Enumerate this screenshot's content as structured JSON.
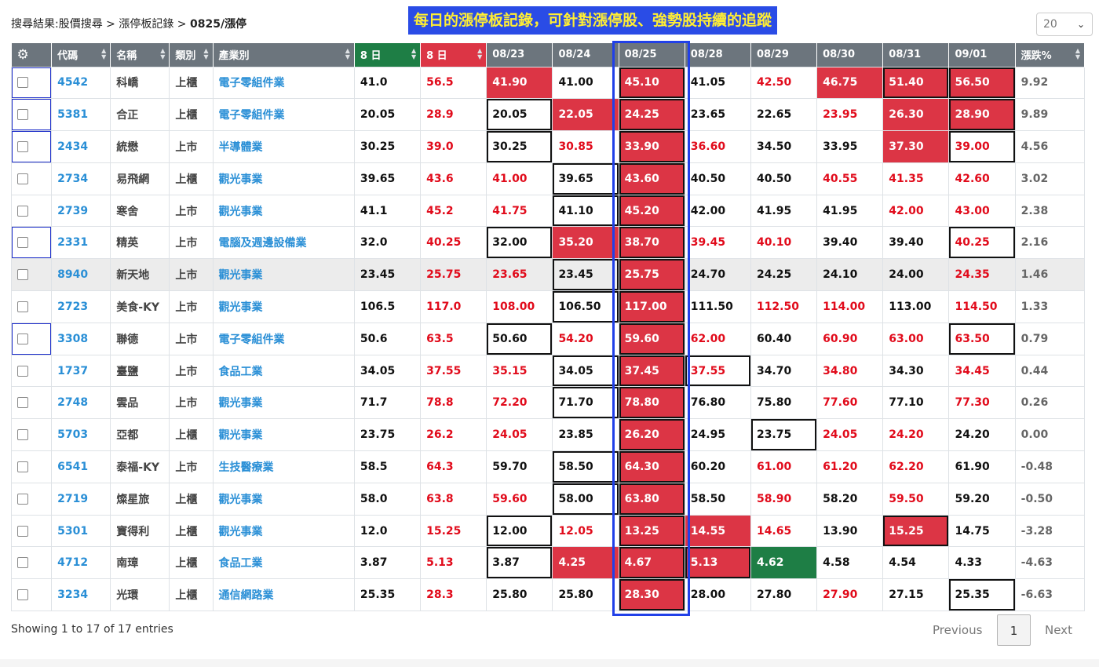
{
  "breadcrumb": {
    "prefix": "搜尋結果:股價搜尋 > 漲停板記錄 > ",
    "current": "0825/漲停"
  },
  "banner": "每日的漲停板記錄，可針對漲停股、強勢股持續的追蹤",
  "page_size": "20",
  "columns": [
    "代碼",
    "名稱",
    "類別",
    "產業別",
    "8 日",
    "8 日",
    "08/23",
    "08/24",
    "08/25",
    "08/28",
    "08/29",
    "08/30",
    "08/31",
    "09/01",
    "漲跌%"
  ],
  "rows": [
    {
      "code": "4542",
      "name": "科嶠",
      "mkt": "上櫃",
      "ind": "電子零組件業",
      "a": "41.0",
      "b": "56.5",
      "d": [
        "41.90",
        "41.00",
        "45.10",
        "41.05",
        "42.50",
        "46.75",
        "51.40",
        "56.50"
      ],
      "s": [
        "up",
        "k",
        "up",
        "k",
        "r",
        "up",
        "up",
        "up"
      ],
      "box": [
        false,
        false,
        true,
        false,
        false,
        false,
        true,
        true
      ],
      "chg": "9.92",
      "sel": true,
      "hl": false
    },
    {
      "code": "5381",
      "name": "合正",
      "mkt": "上櫃",
      "ind": "電子零組件業",
      "a": "20.05",
      "b": "28.9",
      "d": [
        "20.05",
        "22.05",
        "24.25",
        "23.65",
        "22.65",
        "23.95",
        "26.30",
        "28.90"
      ],
      "s": [
        "k",
        "up",
        "up",
        "k",
        "k",
        "r",
        "up",
        "up"
      ],
      "box": [
        true,
        false,
        true,
        false,
        false,
        false,
        false,
        true
      ],
      "chg": "9.89",
      "sel": true,
      "hl": false
    },
    {
      "code": "2434",
      "name": "統懋",
      "mkt": "上市",
      "ind": "半導體業",
      "a": "30.25",
      "b": "39.0",
      "d": [
        "30.25",
        "30.85",
        "33.90",
        "36.60",
        "34.50",
        "33.95",
        "37.30",
        "39.00"
      ],
      "s": [
        "k",
        "r",
        "up",
        "r",
        "k",
        "k",
        "up",
        "r"
      ],
      "box": [
        true,
        false,
        true,
        false,
        false,
        false,
        false,
        true
      ],
      "chg": "4.56",
      "sel": true,
      "hl": false
    },
    {
      "code": "2734",
      "name": "易飛網",
      "mkt": "上櫃",
      "ind": "觀光事業",
      "a": "39.65",
      "b": "43.6",
      "d": [
        "41.00",
        "39.65",
        "43.60",
        "40.50",
        "40.50",
        "40.55",
        "41.35",
        "42.60"
      ],
      "s": [
        "r",
        "k",
        "up",
        "k",
        "k",
        "r",
        "r",
        "r"
      ],
      "box": [
        false,
        true,
        true,
        false,
        false,
        false,
        false,
        false
      ],
      "chg": "3.02",
      "sel": false,
      "hl": false
    },
    {
      "code": "2739",
      "name": "寒舍",
      "mkt": "上市",
      "ind": "觀光事業",
      "a": "41.1",
      "b": "45.2",
      "d": [
        "41.75",
        "41.10",
        "45.20",
        "42.00",
        "41.95",
        "41.95",
        "42.00",
        "43.00"
      ],
      "s": [
        "r",
        "k",
        "up",
        "k",
        "k",
        "k",
        "r",
        "r"
      ],
      "box": [
        false,
        true,
        true,
        false,
        false,
        false,
        false,
        false
      ],
      "chg": "2.38",
      "sel": false,
      "hl": false
    },
    {
      "code": "2331",
      "name": "精英",
      "mkt": "上市",
      "ind": "電腦及週邊設備業",
      "a": "32.0",
      "b": "40.25",
      "d": [
        "32.00",
        "35.20",
        "38.70",
        "39.45",
        "40.10",
        "39.40",
        "39.40",
        "40.25"
      ],
      "s": [
        "k",
        "up",
        "up",
        "r",
        "r",
        "k",
        "k",
        "r"
      ],
      "box": [
        true,
        false,
        true,
        false,
        false,
        false,
        false,
        true
      ],
      "chg": "2.16",
      "sel": true,
      "hl": false
    },
    {
      "code": "8940",
      "name": "新天地",
      "mkt": "上市",
      "ind": "觀光事業",
      "a": "23.45",
      "b": "25.75",
      "d": [
        "23.65",
        "23.45",
        "25.75",
        "24.70",
        "24.25",
        "24.10",
        "24.00",
        "24.35"
      ],
      "s": [
        "r",
        "k",
        "up",
        "k",
        "k",
        "k",
        "k",
        "r"
      ],
      "box": [
        false,
        true,
        true,
        false,
        false,
        false,
        false,
        false
      ],
      "chg": "1.46",
      "sel": false,
      "hl": true
    },
    {
      "code": "2723",
      "name": "美食-KY",
      "mkt": "上市",
      "ind": "觀光事業",
      "a": "106.5",
      "b": "117.0",
      "d": [
        "108.00",
        "106.50",
        "117.00",
        "111.50",
        "112.50",
        "114.00",
        "113.00",
        "114.50"
      ],
      "s": [
        "r",
        "k",
        "up",
        "k",
        "r",
        "r",
        "k",
        "r"
      ],
      "box": [
        false,
        true,
        true,
        false,
        false,
        false,
        false,
        false
      ],
      "chg": "1.33",
      "sel": false,
      "hl": false
    },
    {
      "code": "3308",
      "name": "聯德",
      "mkt": "上市",
      "ind": "電子零組件業",
      "a": "50.6",
      "b": "63.5",
      "d": [
        "50.60",
        "54.20",
        "59.60",
        "62.00",
        "60.40",
        "60.90",
        "63.00",
        "63.50"
      ],
      "s": [
        "k",
        "r",
        "up",
        "r",
        "k",
        "r",
        "r",
        "r"
      ],
      "box": [
        true,
        false,
        true,
        false,
        false,
        false,
        false,
        true
      ],
      "chg": "0.79",
      "sel": true,
      "hl": false
    },
    {
      "code": "1737",
      "name": "臺鹽",
      "mkt": "上市",
      "ind": "食品工業",
      "a": "34.05",
      "b": "37.55",
      "d": [
        "35.15",
        "34.05",
        "37.45",
        "37.55",
        "34.70",
        "34.80",
        "34.30",
        "34.45"
      ],
      "s": [
        "r",
        "k",
        "up",
        "r",
        "k",
        "r",
        "k",
        "r"
      ],
      "box": [
        false,
        true,
        true,
        true,
        false,
        false,
        false,
        false
      ],
      "chg": "0.44",
      "sel": false,
      "hl": false
    },
    {
      "code": "2748",
      "name": "雲品",
      "mkt": "上市",
      "ind": "觀光事業",
      "a": "71.7",
      "b": "78.8",
      "d": [
        "72.20",
        "71.70",
        "78.80",
        "76.80",
        "75.80",
        "77.60",
        "77.10",
        "77.30"
      ],
      "s": [
        "r",
        "k",
        "up",
        "k",
        "k",
        "r",
        "k",
        "r"
      ],
      "box": [
        false,
        true,
        true,
        false,
        false,
        false,
        false,
        false
      ],
      "chg": "0.26",
      "sel": false,
      "hl": false
    },
    {
      "code": "5703",
      "name": "亞都",
      "mkt": "上櫃",
      "ind": "觀光事業",
      "a": "23.75",
      "b": "26.2",
      "d": [
        "24.05",
        "23.85",
        "26.20",
        "24.95",
        "23.75",
        "24.05",
        "24.20",
        "24.20"
      ],
      "s": [
        "r",
        "k",
        "up",
        "k",
        "k",
        "r",
        "r",
        "k"
      ],
      "box": [
        false,
        false,
        true,
        false,
        true,
        false,
        false,
        false
      ],
      "chg": "0.00",
      "sel": false,
      "hl": false
    },
    {
      "code": "6541",
      "name": "泰福-KY",
      "mkt": "上市",
      "ind": "生技醫療業",
      "a": "58.5",
      "b": "64.3",
      "d": [
        "59.70",
        "58.50",
        "64.30",
        "60.20",
        "61.00",
        "61.20",
        "62.20",
        "61.90"
      ],
      "s": [
        "k",
        "k",
        "up",
        "k",
        "r",
        "r",
        "r",
        "k"
      ],
      "box": [
        false,
        true,
        true,
        false,
        false,
        false,
        false,
        false
      ],
      "chg": "-0.48",
      "sel": false,
      "hl": false
    },
    {
      "code": "2719",
      "name": "燦星旅",
      "mkt": "上櫃",
      "ind": "觀光事業",
      "a": "58.0",
      "b": "63.8",
      "d": [
        "59.60",
        "58.00",
        "63.80",
        "58.50",
        "58.90",
        "58.20",
        "59.50",
        "59.20"
      ],
      "s": [
        "r",
        "k",
        "up",
        "k",
        "r",
        "k",
        "r",
        "k"
      ],
      "box": [
        false,
        true,
        true,
        false,
        false,
        false,
        false,
        false
      ],
      "chg": "-0.50",
      "sel": false,
      "hl": false
    },
    {
      "code": "5301",
      "name": "寶得利",
      "mkt": "上櫃",
      "ind": "觀光事業",
      "a": "12.0",
      "b": "15.25",
      "d": [
        "12.00",
        "12.05",
        "13.25",
        "14.55",
        "14.65",
        "13.90",
        "15.25",
        "14.75"
      ],
      "s": [
        "k",
        "r",
        "up",
        "up",
        "r",
        "k",
        "up",
        "k"
      ],
      "box": [
        true,
        false,
        true,
        false,
        false,
        false,
        true,
        false
      ],
      "chg": "-3.28",
      "sel": false,
      "hl": false
    },
    {
      "code": "4712",
      "name": "南璋",
      "mkt": "上櫃",
      "ind": "食品工業",
      "a": "3.87",
      "b": "5.13",
      "d": [
        "3.87",
        "4.25",
        "4.67",
        "5.13",
        "4.62",
        "4.58",
        "4.54",
        "4.33"
      ],
      "s": [
        "k",
        "up",
        "up",
        "up",
        "dn",
        "k",
        "k",
        "k"
      ],
      "box": [
        true,
        false,
        true,
        true,
        false,
        false,
        false,
        false
      ],
      "chg": "-4.63",
      "sel": false,
      "hl": false
    },
    {
      "code": "3234",
      "name": "光環",
      "mkt": "上櫃",
      "ind": "通信網路業",
      "a": "25.35",
      "b": "28.3",
      "d": [
        "25.80",
        "25.80",
        "28.30",
        "28.00",
        "27.80",
        "27.90",
        "27.15",
        "25.35"
      ],
      "s": [
        "k",
        "k",
        "up",
        "k",
        "k",
        "r",
        "k",
        "k"
      ],
      "box": [
        false,
        false,
        true,
        false,
        false,
        false,
        false,
        true
      ],
      "chg": "-6.63",
      "sel": false,
      "hl": false
    }
  ],
  "footer": {
    "info": "Showing 1 to 17 of 17 entries",
    "previous": "Previous",
    "page": "1",
    "next": "Next"
  },
  "colors": {
    "up": "#dc3545",
    "down": "#1e7e45",
    "header": "#6c757d",
    "link": "#2a8fd6",
    "highlight_border": "#2140e8",
    "banner_bg": "#2a4ce6",
    "banner_text": "#ffee33"
  }
}
